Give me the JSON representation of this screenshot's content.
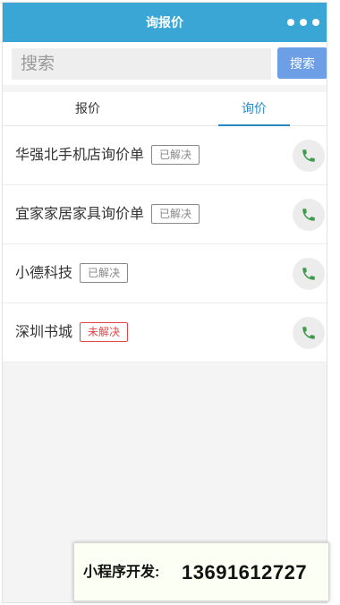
{
  "header": {
    "title": "询报价"
  },
  "search": {
    "placeholder": "搜索",
    "button_label": "搜索"
  },
  "tabs": [
    {
      "label": "报价",
      "active": false
    },
    {
      "label": "询价",
      "active": true
    }
  ],
  "items": [
    {
      "name": "华强北手机店询价单",
      "status": "已解决"
    },
    {
      "name": "宜家家居家具询价单",
      "status": "已解决"
    },
    {
      "name": "小德科技",
      "status": "已解决"
    },
    {
      "name": "深圳书城",
      "status": "未解决"
    }
  ],
  "promo": {
    "label": "小程序开发:",
    "phone": "13691612727"
  },
  "colors": {
    "header": "#3aa6d6",
    "accent": "#2b87c3",
    "search_button": "#6c9fe6",
    "resolved": "#888888",
    "unresolved": "#e04848",
    "phone_icon": "#3f9a4d"
  },
  "icons": {
    "more": "more-dots-icon",
    "call": "phone-icon"
  }
}
